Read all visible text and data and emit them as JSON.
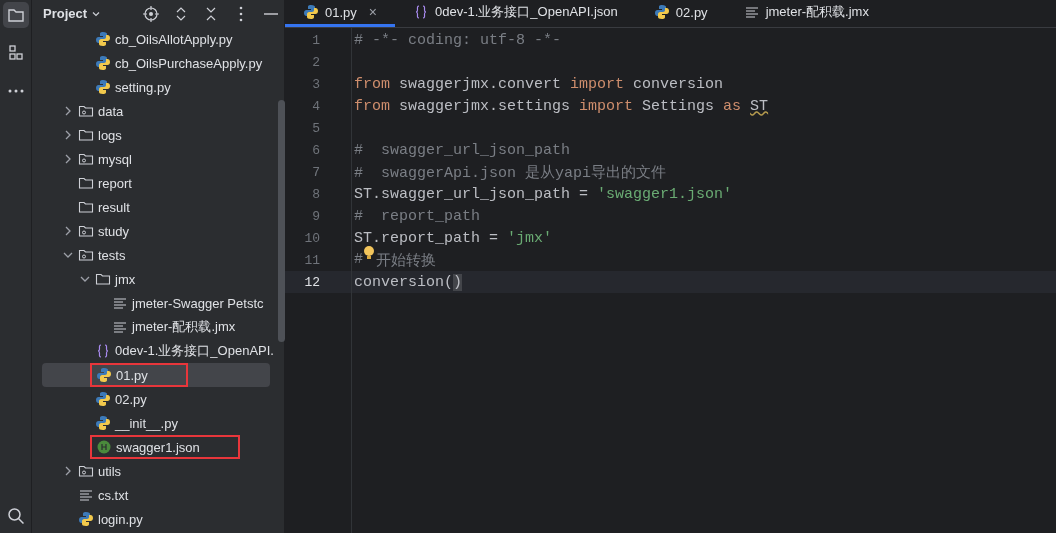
{
  "tool_strip": {
    "top": [
      {
        "kind": "folder",
        "selected": true
      },
      {
        "kind": "structure",
        "selected": false
      },
      {
        "kind": "more",
        "selected": false
      }
    ],
    "bottom": [
      {
        "kind": "search",
        "selected": false
      }
    ]
  },
  "project_panel": {
    "title": "Project",
    "tools": [
      {
        "kind": "locate"
      },
      {
        "kind": "expand"
      },
      {
        "kind": "collapse"
      },
      {
        "kind": "more"
      },
      {
        "kind": "hide"
      }
    ],
    "tree": [
      {
        "children": [
          {
            "label": "cb_OilsAllotApply.py",
            "kind": "python",
            "selected": false,
            "marked": false
          },
          {
            "label": "cb_OilsPurchaseApply.py",
            "kind": "python",
            "selected": false,
            "marked": false
          },
          {
            "label": "setting.py",
            "kind": "python",
            "selected": false,
            "marked": false
          }
        ]
      },
      {
        "label": "data",
        "kind": "package",
        "expanded": false,
        "selected": false,
        "marked": false
      },
      {
        "label": "logs",
        "kind": "folder",
        "expanded": false,
        "selected": false,
        "marked": false
      },
      {
        "label": "mysql",
        "kind": "package",
        "expanded": false,
        "selected": false,
        "marked": false
      },
      {
        "label": "report",
        "kind": "folder",
        "selected": false,
        "marked": false
      },
      {
        "label": "result",
        "kind": "folder",
        "selected": false,
        "marked": false
      },
      {
        "label": "study",
        "kind": "package",
        "expanded": false,
        "selected": false,
        "marked": false
      },
      {
        "label": "tests",
        "kind": "package",
        "expanded": true,
        "selected": false,
        "marked": false,
        "children": [
          {
            "label": "jmx",
            "kind": "folder",
            "expanded": true,
            "selected": false,
            "marked": false,
            "children": [
              {
                "label": "jmeter-Swagger Petstc",
                "kind": "text",
                "selected": false,
                "marked": false
              },
              {
                "label": "jmeter-配积载.jmx",
                "kind": "text",
                "selected": false,
                "marked": false
              }
            ]
          },
          {
            "label": "0dev-1.业务接口_OpenAPI.",
            "kind": "openapi",
            "selected": false,
            "marked": false
          },
          {
            "label": "01.py",
            "kind": "python",
            "selected": true,
            "marked": true
          },
          {
            "label": "02.py",
            "kind": "python",
            "selected": false,
            "marked": false
          },
          {
            "label": "__init__.py",
            "kind": "python",
            "selected": false,
            "marked": false
          },
          {
            "label": "swagger1.json",
            "kind": "json",
            "selected": false,
            "marked": true
          }
        ]
      },
      {
        "label": "utils",
        "kind": "package",
        "expanded": false,
        "selected": false,
        "marked": false
      },
      {
        "label": "cs.txt",
        "kind": "text",
        "selected": false,
        "marked": false
      },
      {
        "label": "login.py",
        "kind": "python",
        "selected": false,
        "marked": false
      }
    ]
  },
  "editor": {
    "tabs": [
      {
        "label": "01.py",
        "kind": "python",
        "selected": true,
        "close": "×"
      },
      {
        "label": "0dev-1.业务接口_OpenAPI.json",
        "kind": "openapi",
        "selected": false
      },
      {
        "label": "02.py",
        "kind": "python",
        "selected": false
      },
      {
        "label": "jmeter-配积载.jmx",
        "kind": "text",
        "selected": false
      }
    ],
    "lines": [
      {
        "number": "1",
        "current": false,
        "tokens": [
          {
            "text": "# -*- coding: utf-8 -*-",
            "kind": "comment"
          }
        ]
      },
      {
        "number": "2",
        "current": false
      },
      {
        "number": "3",
        "current": false,
        "tokens": [
          {
            "text": "from",
            "kind": "keyword"
          },
          {
            "text": " swaggerjmx.convert ",
            "kind": "plain"
          },
          {
            "text": "import",
            "kind": "keyword"
          },
          {
            "text": " conversion",
            "kind": "plain"
          }
        ]
      },
      {
        "number": "4",
        "current": false,
        "tokens": [
          {
            "text": "from",
            "kind": "keyword"
          },
          {
            "text": " swaggerjmx.settings ",
            "kind": "plain"
          },
          {
            "text": "import",
            "kind": "keyword"
          },
          {
            "text": " Settings ",
            "kind": "plain"
          },
          {
            "text": "as ",
            "kind": "keyword"
          },
          {
            "text": "ST",
            "kind": "plain",
            "warning": true
          }
        ]
      },
      {
        "number": "5",
        "current": false
      },
      {
        "number": "6",
        "current": false,
        "tokens": [
          {
            "text": "#  swagger_url_json_path",
            "kind": "comment"
          }
        ]
      },
      {
        "number": "7",
        "current": false,
        "tokens": [
          {
            "text": "#  swaggerApi.json 是从yapi导出的文件",
            "kind": "comment"
          }
        ]
      },
      {
        "number": "8",
        "current": false,
        "tokens": [
          {
            "text": "ST.swagger_url_json_path = ",
            "kind": "plain"
          },
          {
            "text": "'swagger1.json'",
            "kind": "string"
          }
        ]
      },
      {
        "number": "9",
        "current": false,
        "tokens": [
          {
            "text": "#  report_path",
            "kind": "comment"
          }
        ]
      },
      {
        "number": "10",
        "current": false,
        "tokens": [
          {
            "text": "ST.report_path = ",
            "kind": "plain"
          },
          {
            "text": "'jmx'",
            "kind": "string"
          }
        ]
      },
      {
        "number": "11",
        "current": false,
        "bulb": true,
        "tokens": [
          {
            "text": "#",
            "kind": "comment"
          },
          {
            "text": "开始转换",
            "kind": "comment"
          }
        ]
      },
      {
        "number": "12",
        "current": true,
        "tokens": [
          {
            "text": "conversion(",
            "kind": "plain"
          },
          {
            "text": ")",
            "kind": "plain",
            "matched": true
          }
        ]
      }
    ]
  }
}
